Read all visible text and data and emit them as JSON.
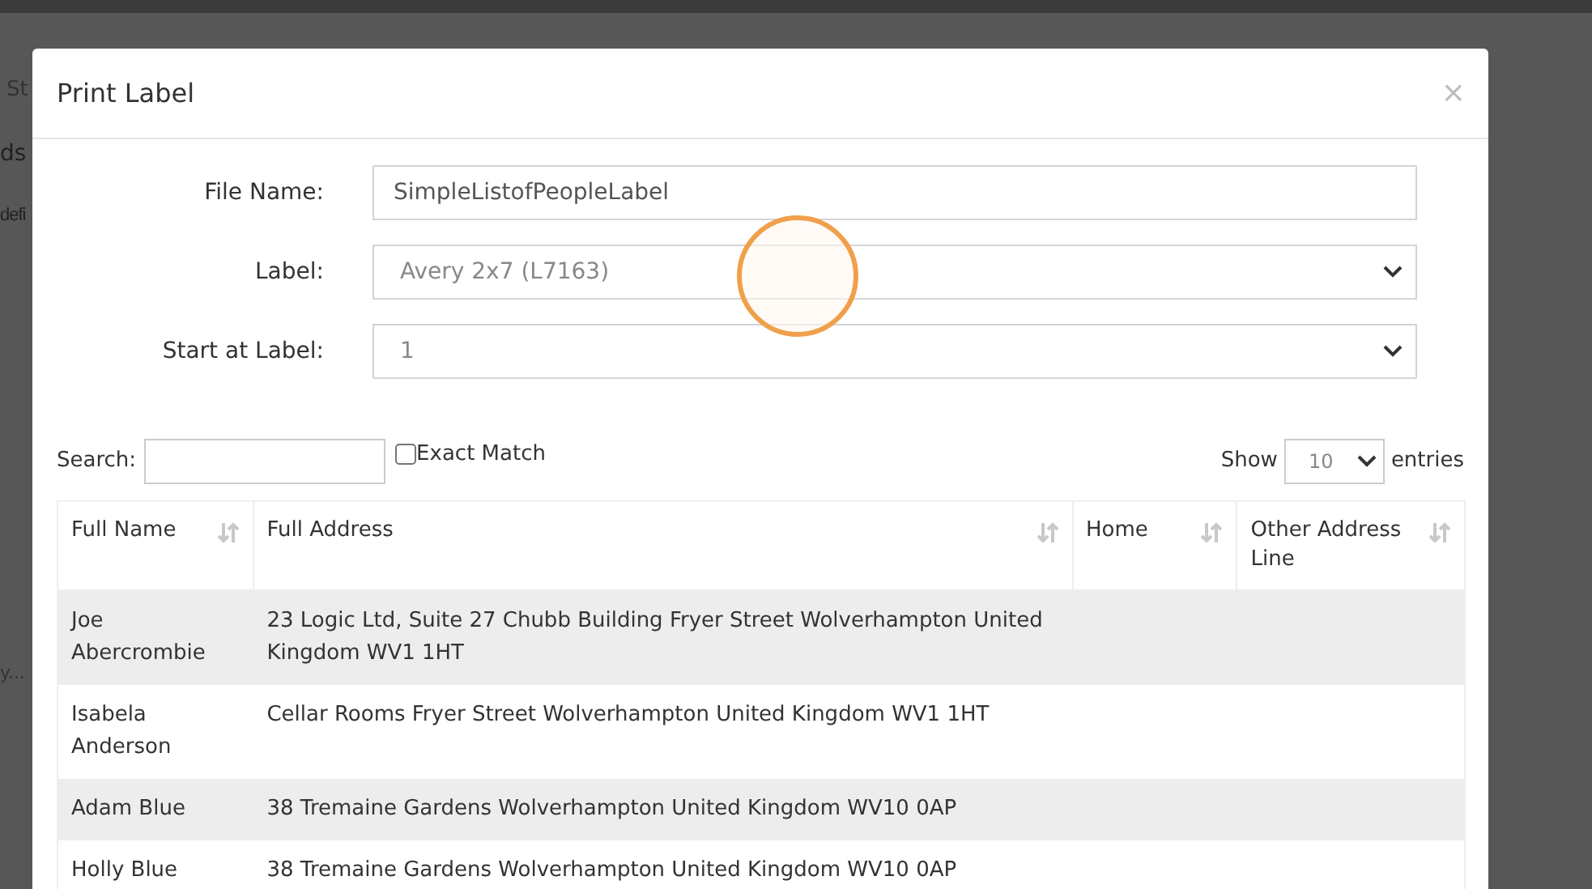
{
  "background_fragments": [
    "St",
    "ds",
    "defi",
    "y..."
  ],
  "dialog": {
    "title": "Print Label",
    "close": "×"
  },
  "form": [
    {
      "label": "File Name:",
      "kind": "text",
      "value": "SimpleListofPeopleLabel"
    },
    {
      "label": "Label:",
      "kind": "select",
      "value": "Avery 2x7 (L7163)"
    },
    {
      "label": "Start at Label:",
      "kind": "select",
      "value": "1"
    }
  ],
  "search": {
    "label": "Search:",
    "exact_match": {
      "label": "Exact Match",
      "checked": false
    }
  },
  "length": {
    "before": "Show",
    "value": "10",
    "after": "entries"
  },
  "table": {
    "columns": [
      "Full Name",
      "Full Address",
      "Home",
      "Other Address Line"
    ],
    "rows": [
      [
        "Joe Abercrombie",
        "23 Logic Ltd, Suite 27 Chubb Building Fryer Street Wolverhampton United Kingdom WV1 1HT",
        "",
        ""
      ],
      [
        "Isabela Anderson",
        "Cellar Rooms Fryer Street Wolverhampton United Kingdom WV1 1HT",
        "",
        ""
      ],
      [
        "Adam Blue",
        "38 Tremaine Gardens Wolverhampton United Kingdom WV10 0AP",
        "",
        ""
      ],
      [
        "Holly Blue",
        "38 Tremaine Gardens Wolverhampton United Kingdom WV10 0AP",
        "",
        ""
      ]
    ]
  }
}
